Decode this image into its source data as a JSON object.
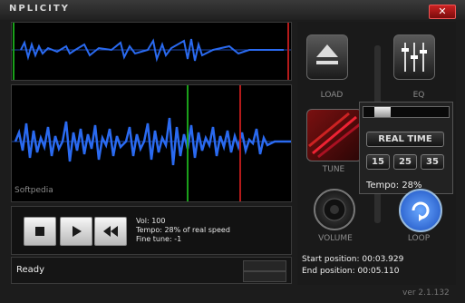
{
  "app": {
    "title": "NPLICITY",
    "close_symbol": "✕",
    "version": "ver 2.1.132"
  },
  "waveform": {
    "watermark": "Softpedia",
    "wave_color": "#2a6af0"
  },
  "transport": {
    "info_lines": {
      "vol": "Vol: 100",
      "tempo": "Tempo: 28% of real speed",
      "fine": "Fine tune: -1"
    }
  },
  "status": {
    "text": "Ready"
  },
  "side": {
    "load_label": "LOAD",
    "eq_label": "EQ",
    "tune_label": "TUNE",
    "volume_label": "VOLUME",
    "loop_label": "LOOP",
    "realtime_label": "REAL TIME",
    "presets": [
      "15",
      "25",
      "35"
    ],
    "tempo_text": "Tempo: 28%",
    "start_position": "Start position: 00:03.929",
    "end_position": "End position:  00:05.110"
  }
}
